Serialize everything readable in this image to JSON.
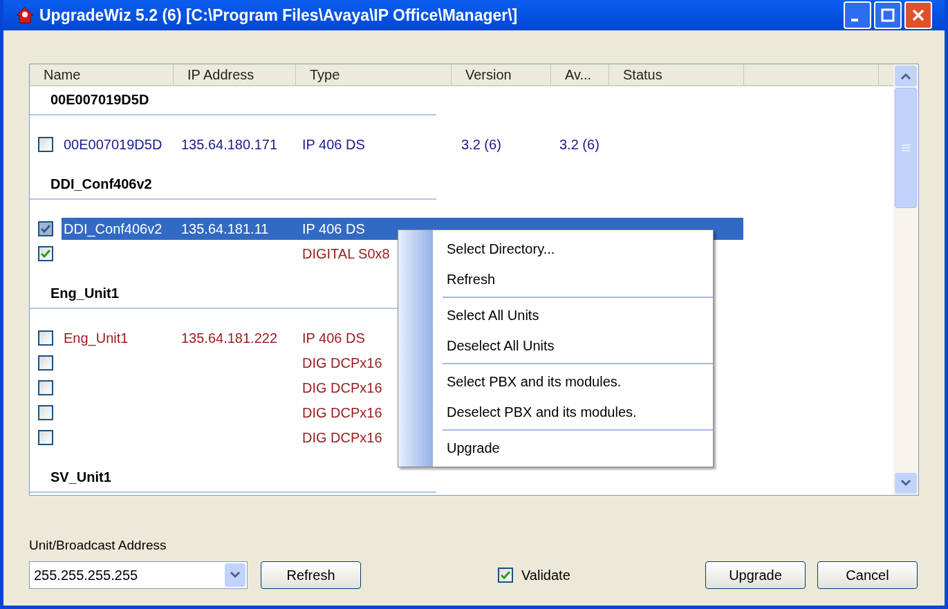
{
  "window": {
    "title": "UpgradeWiz 5.2 (6) [C:\\Program Files\\Avaya\\IP Office\\Manager\\]"
  },
  "table": {
    "columns": [
      "Name",
      "IP Address",
      "Type",
      "Version",
      "Av...",
      "Status"
    ],
    "groups": [
      {
        "name": "00E007019D5D",
        "units": [
          {
            "name": "00E007019D5D",
            "ip": "135.64.180.171",
            "type": "IP 406 DS",
            "version": "3.2 (6)",
            "available": "3.2 (6)",
            "checked": false,
            "selected": false,
            "color": "#1a1a8c"
          }
        ]
      },
      {
        "name": "DDI_Conf406v2",
        "units": [
          {
            "name": "DDI_Conf406v2",
            "ip": "135.64.181.11",
            "type": "IP 406 DS",
            "checked": true,
            "selected": true
          },
          {
            "type": "DIGITAL S0x8",
            "checked": true,
            "selected": false,
            "color": "#9a1b1b"
          }
        ]
      },
      {
        "name": "Eng_Unit1",
        "units": [
          {
            "name": "Eng_Unit1",
            "ip": "135.64.181.222",
            "type": "IP 406 DS",
            "checked": false,
            "selected": false,
            "color": "#9a1b1b"
          },
          {
            "type": "DIG DCPx16",
            "checked": false,
            "selected": false,
            "color": "#9a1b1b"
          },
          {
            "type": "DIG DCPx16",
            "checked": false,
            "selected": false,
            "color": "#9a1b1b"
          },
          {
            "type": "DIG DCPx16",
            "checked": false,
            "selected": false,
            "color": "#9a1b1b"
          },
          {
            "type": "DIG DCPx16",
            "checked": false,
            "selected": false,
            "color": "#9a1b1b"
          }
        ]
      },
      {
        "name": "SV_Unit1"
      }
    ]
  },
  "context_menu": {
    "sections": [
      [
        "Select Directory...",
        "Refresh"
      ],
      [
        "Select All Units",
        "Deselect All Units"
      ],
      [
        "Select PBX and its modules.",
        "Deselect PBX and its modules."
      ],
      [
        "Upgrade"
      ]
    ]
  },
  "address": {
    "label": "Unit/Broadcast Address",
    "value": "255.255.255.255"
  },
  "refresh_button": "Refresh",
  "validate": {
    "label": "Validate",
    "checked": true
  },
  "buttons": [
    "Upgrade",
    "Cancel"
  ]
}
